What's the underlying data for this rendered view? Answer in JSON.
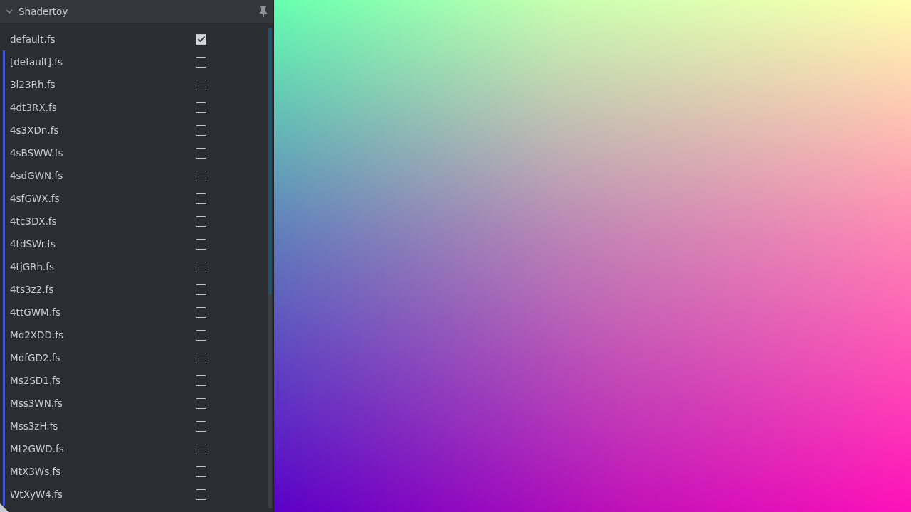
{
  "panel": {
    "title": "Shadertoy",
    "expanded": true
  },
  "files": [
    {
      "name": "default.fs",
      "checked": true,
      "kind": "main"
    },
    {
      "name": "[default].fs",
      "checked": false,
      "kind": "variant"
    },
    {
      "name": "3l23Rh.fs",
      "checked": false,
      "kind": "variant"
    },
    {
      "name": "4dt3RX.fs",
      "checked": false,
      "kind": "variant"
    },
    {
      "name": "4s3XDn.fs",
      "checked": false,
      "kind": "variant"
    },
    {
      "name": "4sBSWW.fs",
      "checked": false,
      "kind": "variant"
    },
    {
      "name": "4sdGWN.fs",
      "checked": false,
      "kind": "variant"
    },
    {
      "name": "4sfGWX.fs",
      "checked": false,
      "kind": "variant"
    },
    {
      "name": "4tc3DX.fs",
      "checked": false,
      "kind": "variant"
    },
    {
      "name": "4tdSWr.fs",
      "checked": false,
      "kind": "variant"
    },
    {
      "name": "4tjGRh.fs",
      "checked": false,
      "kind": "variant"
    },
    {
      "name": "4ts3z2.fs",
      "checked": false,
      "kind": "variant"
    },
    {
      "name": "4ttGWM.fs",
      "checked": false,
      "kind": "variant"
    },
    {
      "name": "Md2XDD.fs",
      "checked": false,
      "kind": "variant"
    },
    {
      "name": "MdfGD2.fs",
      "checked": false,
      "kind": "variant"
    },
    {
      "name": "Ms2SD1.fs",
      "checked": false,
      "kind": "variant"
    },
    {
      "name": "Mss3WN.fs",
      "checked": false,
      "kind": "variant"
    },
    {
      "name": "Mss3zH.fs",
      "checked": false,
      "kind": "variant"
    },
    {
      "name": "Mt2GWD.fs",
      "checked": false,
      "kind": "variant"
    },
    {
      "name": "MtX3Ws.fs",
      "checked": false,
      "kind": "variant"
    },
    {
      "name": "WtXyW4.fs",
      "checked": false,
      "kind": "variant"
    }
  ]
}
